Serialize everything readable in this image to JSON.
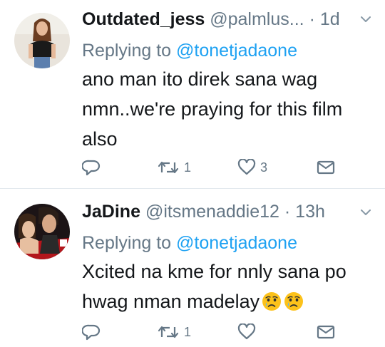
{
  "tweets": [
    {
      "name": "Outdated_jess",
      "handle": "@palmlus...",
      "separator": "·",
      "time": "1d",
      "replying_prefix": "Replying to",
      "replying_handle": "@tonetjadaone",
      "body_lines": [
        "ano man ito direk sana wag",
        "nmn..we're praying for this film",
        "also"
      ],
      "retweet_count": "1",
      "like_count": "3"
    },
    {
      "name": "JaDine",
      "handle": "@itsmenaddie12",
      "separator": "·",
      "time": "13h",
      "replying_prefix": "Replying to",
      "replying_handle": "@tonetjadaone",
      "body_lines": [
        "Xcited na kme for nnly sana po",
        "hwag nman madelay"
      ],
      "emojis": [
        "crying-face",
        "crying-face"
      ],
      "retweet_count": "1",
      "like_count": ""
    }
  ],
  "colors": {
    "text": "#14171a",
    "secondary": "#657786",
    "link": "#1da1f2",
    "divider": "#e1e8ed"
  },
  "icons": [
    "reply-icon",
    "retweet-icon",
    "like-icon",
    "direct-message-icon",
    "chevron-down-icon"
  ]
}
